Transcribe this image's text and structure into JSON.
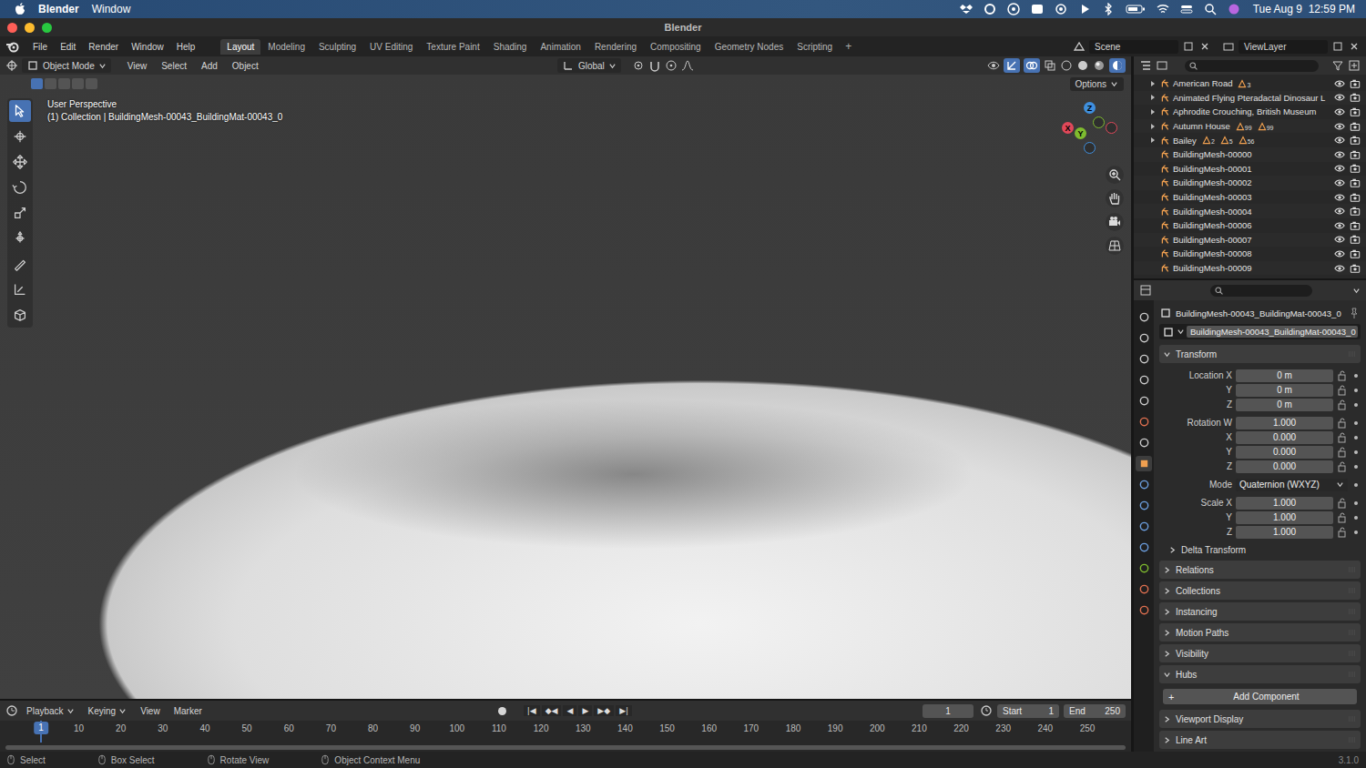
{
  "menubar": {
    "app": "Blender",
    "items": [
      "Window"
    ],
    "clock": "Tue Aug 9  12:59 PM"
  },
  "window": {
    "title": "Blender"
  },
  "topbar": {
    "menus": [
      "File",
      "Edit",
      "Render",
      "Window",
      "Help"
    ],
    "workspaces": [
      {
        "label": "Layout",
        "selected": true
      },
      {
        "label": "Modeling",
        "selected": false
      },
      {
        "label": "Sculpting",
        "selected": false
      },
      {
        "label": "UV Editing",
        "selected": false
      },
      {
        "label": "Texture Paint",
        "selected": false
      },
      {
        "label": "Shading",
        "selected": false
      },
      {
        "label": "Animation",
        "selected": false
      },
      {
        "label": "Rendering",
        "selected": false
      },
      {
        "label": "Compositing",
        "selected": false
      },
      {
        "label": "Geometry Nodes",
        "selected": false
      },
      {
        "label": "Scripting",
        "selected": false
      }
    ],
    "add_workspace": "+",
    "scene": "Scene",
    "view_layer": "ViewLayer"
  },
  "viewport": {
    "mode": "Object Mode",
    "menus": [
      "View",
      "Select",
      "Add",
      "Object"
    ],
    "orientation": "Global",
    "options": "Options",
    "info": [
      "User Perspective",
      "(1) Collection | BuildingMesh-00043_BuildingMat-00043_0"
    ],
    "axes": [
      {
        "label": "X",
        "color": "#e0485a"
      },
      {
        "label": "Y",
        "color": "#7fbb2f"
      },
      {
        "label": "Z",
        "color": "#3f8fde"
      }
    ],
    "tools": [
      {
        "selected": true
      },
      {
        "selected": false
      },
      {
        "selected": false
      },
      {
        "selected": false
      },
      {
        "selected": false
      },
      {
        "selected": false
      },
      {
        "selected": false
      },
      {
        "selected": false
      },
      {
        "selected": false
      }
    ]
  },
  "outliner": {
    "items": [
      {
        "label": "American Road",
        "expandable": true,
        "badges": [
          "3"
        ],
        "visible": true,
        "renderable": true
      },
      {
        "label": "Animated Flying Pteradactal Dinosaur L",
        "expandable": true,
        "badges": [],
        "visible": true,
        "renderable": true
      },
      {
        "label": "Aphrodite Crouching, British Museum",
        "expandable": true,
        "badges": [],
        "visible": true,
        "renderable": true
      },
      {
        "label": "Autumn House",
        "expandable": true,
        "badges": [
          "99",
          "99"
        ],
        "visible": true,
        "renderable": true
      },
      {
        "label": "Bailey",
        "expandable": true,
        "badges": [
          "2",
          "5",
          "56"
        ],
        "visible": true,
        "renderable": true
      },
      {
        "label": "BuildingMesh-00000",
        "expandable": false,
        "badges": [],
        "visible": true,
        "renderable": true
      },
      {
        "label": "BuildingMesh-00001",
        "expandable": false,
        "badges": [],
        "visible": true,
        "renderable": true
      },
      {
        "label": "BuildingMesh-00002",
        "expandable": false,
        "badges": [],
        "visible": true,
        "renderable": true
      },
      {
        "label": "BuildingMesh-00003",
        "expandable": false,
        "badges": [],
        "visible": true,
        "renderable": true
      },
      {
        "label": "BuildingMesh-00004",
        "expandable": false,
        "badges": [],
        "visible": true,
        "renderable": true
      },
      {
        "label": "BuildingMesh-00006",
        "expandable": false,
        "badges": [],
        "visible": true,
        "renderable": true
      },
      {
        "label": "BuildingMesh-00007",
        "expandable": false,
        "badges": [],
        "visible": true,
        "renderable": true
      },
      {
        "label": "BuildingMesh-00008",
        "expandable": false,
        "badges": [],
        "visible": true,
        "renderable": true
      },
      {
        "label": "BuildingMesh-00009",
        "expandable": false,
        "badges": [],
        "visible": true,
        "renderable": true
      }
    ]
  },
  "properties": {
    "tabs": [
      {
        "selected": false
      },
      {
        "selected": false
      },
      {
        "selected": false
      },
      {
        "selected": false
      },
      {
        "selected": false
      },
      {
        "selected": false
      },
      {
        "selected": false
      },
      {
        "selected": true
      },
      {
        "selected": false
      },
      {
        "selected": false
      },
      {
        "selected": false
      },
      {
        "selected": false
      },
      {
        "selected": false
      },
      {
        "selected": false
      },
      {
        "selected": false
      }
    ],
    "object_name": "BuildingMesh-00043_BuildingMat-00043_0",
    "data_name": "BuildingMesh-00043_BuildingMat-00043_0",
    "transform": {
      "label": "Transform",
      "expanded": true,
      "groups": [
        [
          {
            "label": "Location X",
            "value": "0 m",
            "kind": "number"
          },
          {
            "label": "Y",
            "value": "0 m",
            "kind": "number"
          },
          {
            "label": "Z",
            "value": "0 m",
            "kind": "number"
          }
        ],
        [
          {
            "label": "Rotation W",
            "value": "1.000",
            "kind": "number"
          },
          {
            "label": "X",
            "value": "0.000",
            "kind": "number"
          },
          {
            "label": "Y",
            "value": "0.000",
            "kind": "number"
          },
          {
            "label": "Z",
            "value": "0.000",
            "kind": "number"
          }
        ],
        [
          {
            "label": "Mode",
            "value": "Quaternion (WXYZ)",
            "kind": "dropdown"
          }
        ],
        [
          {
            "label": "Scale X",
            "value": "1.000",
            "kind": "number"
          },
          {
            "label": "Y",
            "value": "1.000",
            "kind": "number"
          },
          {
            "label": "Z",
            "value": "1.000",
            "kind": "number"
          }
        ]
      ],
      "sub": {
        "label": "Delta Transform",
        "expanded": false
      }
    },
    "panels": [
      {
        "label": "Relations",
        "expanded": false
      },
      {
        "label": "Collections",
        "expanded": false
      },
      {
        "label": "Instancing",
        "expanded": false
      },
      {
        "label": "Motion Paths",
        "expanded": false
      },
      {
        "label": "Visibility",
        "expanded": false
      },
      {
        "label": "Hubs",
        "expanded": true,
        "button": "Add Component",
        "button_icon": "+"
      },
      {
        "label": "Viewport Display",
        "expanded": false
      },
      {
        "label": "Line Art",
        "expanded": false
      }
    ]
  },
  "timeline": {
    "menus": [
      {
        "label": "Playback",
        "dropdown": true
      },
      {
        "label": "Keying",
        "dropdown": true
      },
      {
        "label": "View",
        "dropdown": false
      },
      {
        "label": "Marker",
        "dropdown": false
      }
    ],
    "controls": [
      "|◀",
      "◆◀",
      "◀",
      "▶",
      "▶◆",
      "▶|"
    ],
    "frame": "1",
    "start": {
      "label": "Start",
      "value": "1"
    },
    "end": {
      "label": "End",
      "value": "250"
    },
    "current_frame": "1",
    "ticks": [
      "10",
      "20",
      "30",
      "40",
      "50",
      "60",
      "70",
      "80",
      "90",
      "100",
      "110",
      "120",
      "130",
      "140",
      "150",
      "160",
      "170",
      "180",
      "190",
      "200",
      "210",
      "220",
      "230",
      "240",
      "250"
    ]
  },
  "status": {
    "items": [
      "Select",
      "Box Select",
      "Rotate View",
      "Object Context Menu"
    ],
    "version": "3.1.0"
  }
}
